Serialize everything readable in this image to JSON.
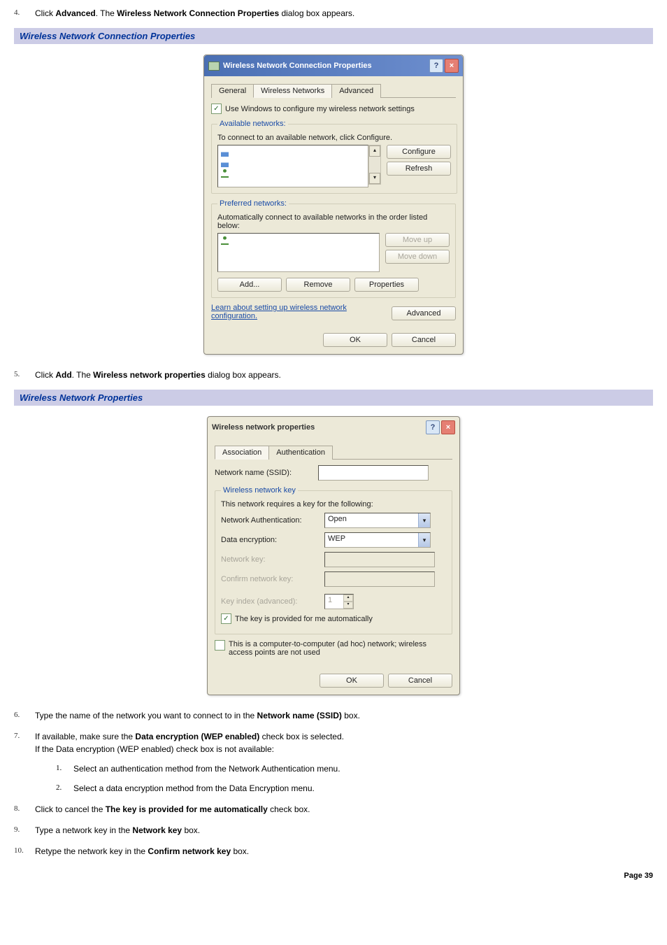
{
  "steps": {
    "s4": {
      "num": "4.",
      "text_a": "Click ",
      "bold_a": "Advanced",
      "text_b": ". The ",
      "bold_b": "Wireless Network Connection Properties",
      "text_c": " dialog box appears."
    },
    "s5": {
      "num": "5.",
      "text_a": "Click ",
      "bold_a": "Add",
      "text_b": ". The ",
      "bold_b": "Wireless network properties",
      "text_c": " dialog box appears."
    },
    "s6": {
      "num": "6.",
      "text_a": "Type the name of the network you want to connect to in the ",
      "bold_a": "Network name (SSID)",
      "text_b": " box."
    },
    "s7": {
      "num": "7.",
      "text_a": "If available, make sure the ",
      "bold_a": "Data encryption (WEP enabled)",
      "text_b": " check box is selected.",
      "line2": "If the Data encryption (WEP enabled) check box is not available:"
    },
    "s7_1": {
      "num": "1.",
      "text": "Select an authentication method from the Network Authentication menu."
    },
    "s7_2": {
      "num": "2.",
      "text": "Select a data encryption method from the Data Encryption menu."
    },
    "s8": {
      "num": "8.",
      "text_a": "Click to cancel the ",
      "bold_a": "The key is provided for me automatically",
      "text_b": " check box."
    },
    "s9": {
      "num": "9.",
      "text_a": "Type a network key in the ",
      "bold_a": "Network key",
      "text_b": " box."
    },
    "s10": {
      "num": "10.",
      "text_a": "Retype the network key in the ",
      "bold_a": "Confirm network key",
      "text_b": " box."
    }
  },
  "section1": {
    "title": "Wireless Network Connection Properties"
  },
  "section2": {
    "title": "Wireless Network Properties"
  },
  "dialog1": {
    "title": "Wireless Network Connection Properties",
    "help": "?",
    "close": "×",
    "tabs": {
      "general": "General",
      "wireless": "Wireless Networks",
      "advanced": "Advanced"
    },
    "use_windows": "Use Windows to configure my wireless network settings",
    "available": {
      "legend": "Available networks:",
      "hint": "To connect to an available network, click Configure.",
      "configure": "Configure",
      "refresh": "Refresh"
    },
    "preferred": {
      "legend": "Preferred networks:",
      "hint": "Automatically connect to available networks in the order listed below:",
      "moveup": "Move up",
      "movedown": "Move down",
      "add": "Add...",
      "remove": "Remove",
      "properties": "Properties"
    },
    "learn": "Learn about setting up wireless network configuration.",
    "advanced_btn": "Advanced",
    "ok": "OK",
    "cancel": "Cancel"
  },
  "dialog2": {
    "title": "Wireless network properties",
    "help": "?",
    "close": "×",
    "tabs": {
      "assoc": "Association",
      "auth": "Authentication"
    },
    "ssid_label": "Network name (SSID):",
    "key_legend": "Wireless network key",
    "key_hint": "This network requires a key for the following:",
    "net_auth_label": "Network Authentication:",
    "net_auth_value": "Open",
    "data_enc_label": "Data encryption:",
    "data_enc_value": "WEP",
    "netkey_label": "Network key:",
    "confirmkey_label": "Confirm network key:",
    "keyindex_label": "Key index (advanced):",
    "keyindex_value": "1",
    "auto_key": "The key is provided for me automatically",
    "adhoc": "This is a computer-to-computer (ad hoc) network; wireless access points are not used",
    "ok": "OK",
    "cancel": "Cancel"
  },
  "page": {
    "num": "Page 39"
  }
}
